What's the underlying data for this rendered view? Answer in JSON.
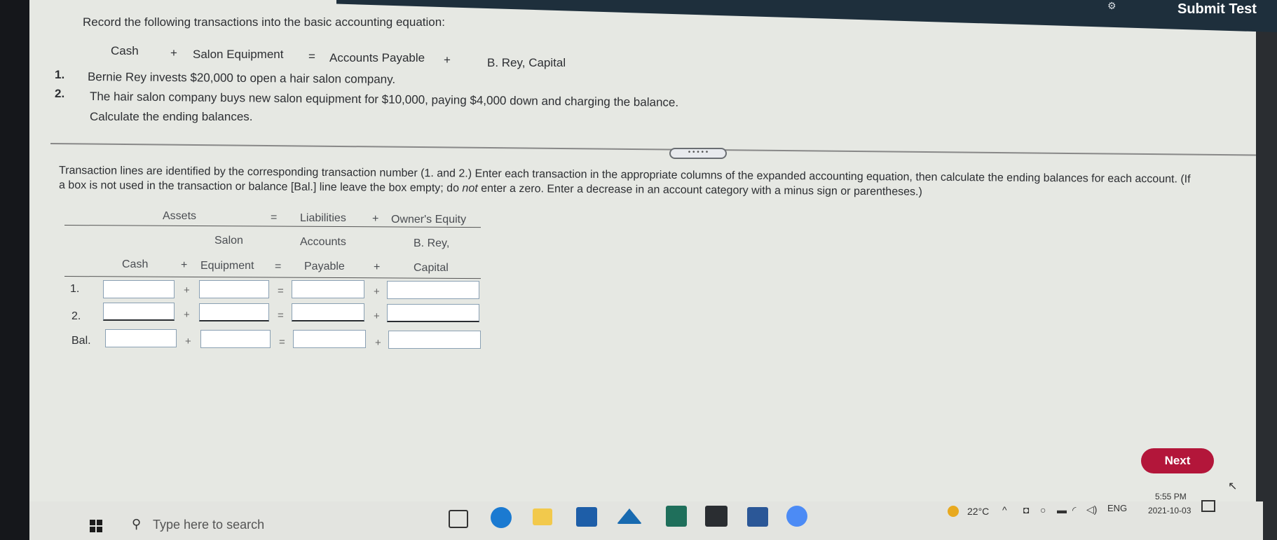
{
  "header": {
    "submit_label": "Submit Test"
  },
  "question": {
    "intro": "Record the following transactions into the basic accounting equation:",
    "equation": {
      "cash": "Cash",
      "plus1": "+",
      "salon_equipment": "Salon Equipment",
      "equals": "=",
      "accounts_payable": "Accounts Payable",
      "plus2": "+",
      "capital": "B. Rey, Capital"
    },
    "items": [
      {
        "num": "1.",
        "text": "Bernie Rey invests $20,000 to open a hair salon company."
      },
      {
        "num": "2.",
        "text": "The hair salon company buys new salon equipment for $10,000, paying $4,000 down and charging the balance."
      }
    ],
    "calc": "Calculate the ending balances."
  },
  "divider_handle": "• • • • •",
  "instructions": {
    "line1": "Transaction lines are identified by the corresponding transaction number (1. and 2.) Enter each transaction in the appropriate columns of the expanded accounting equation, then calculate the ending balances for each account. (If",
    "line2_a": "a box is not used in the transaction or balance [Bal.] line leave the box empty; do ",
    "line2_em": "not",
    "line2_b": " enter a zero. Enter a decrease in an account category with a minus sign or parentheses.)"
  },
  "table": {
    "assets": "Assets",
    "eq": "=",
    "liabilities": "Liabilities",
    "plus_oe": "+",
    "owners_equity": "Owner's Equity",
    "salon": "Salon",
    "accounts": "Accounts",
    "brey": "B. Rey,",
    "cash": "Cash",
    "plus_a": "+",
    "equipment": "Equipment",
    "eq2": "=",
    "payable": "Payable",
    "plus_b": "+",
    "capital": "Capital",
    "rows": [
      {
        "label": "1.",
        "op1": "+",
        "op2": "=",
        "op3": "+"
      },
      {
        "label": "2.",
        "op1": "+",
        "op2": "=",
        "op3": "+"
      },
      {
        "label": "Bal.",
        "op1": "+",
        "op2": "=",
        "op3": "+"
      }
    ]
  },
  "next_label": "Next",
  "taskbar": {
    "search_placeholder": "Type here to search",
    "temperature": "22°C",
    "language": "ENG",
    "time": "5:55 PM",
    "date": "2021-10-03"
  }
}
